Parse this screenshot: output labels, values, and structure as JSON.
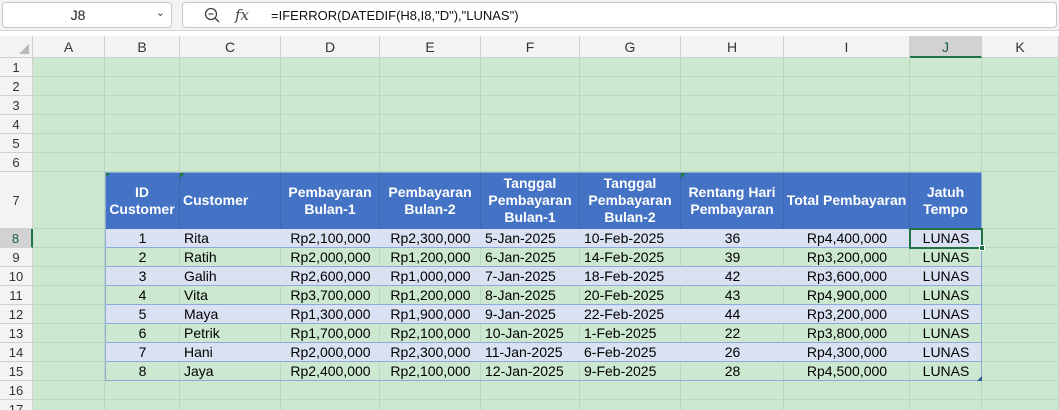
{
  "formula_bar": {
    "name_box": "J8",
    "fx_label": "fx",
    "formula": "=IFERROR(DATEDIF(H8,I8,\"D\"),\"LUNAS\")"
  },
  "columns": [
    "A",
    "B",
    "C",
    "D",
    "E",
    "F",
    "G",
    "H",
    "I",
    "J",
    "K"
  ],
  "selected_column": "J",
  "rows": [
    "1",
    "2",
    "3",
    "4",
    "5",
    "6",
    "7",
    "8",
    "9",
    "10",
    "11",
    "12",
    "13",
    "14",
    "15",
    "16",
    "17"
  ],
  "selected_row": "8",
  "table": {
    "headers": [
      "ID Customer",
      "Customer",
      "Pembayaran Bulan-1",
      "Pembayaran Bulan-2",
      "Tanggal Pembayaran Bulan-1",
      "Tanggal Pembayaran Bulan-2",
      "Rentang Hari Pembayaran",
      "Total Pembayaran",
      "Jatuh Tempo"
    ],
    "rows": [
      [
        "1",
        "Rita",
        "Rp2,100,000",
        "Rp2,300,000",
        "5-Jan-2025",
        "10-Feb-2025",
        "36",
        "Rp4,400,000",
        "LUNAS"
      ],
      [
        "2",
        "Ratih",
        "Rp2,000,000",
        "Rp1,200,000",
        "6-Jan-2025",
        "14-Feb-2025",
        "39",
        "Rp3,200,000",
        "LUNAS"
      ],
      [
        "3",
        "Galih",
        "Rp2,600,000",
        "Rp1,000,000",
        "7-Jan-2025",
        "18-Feb-2025",
        "42",
        "Rp3,600,000",
        "LUNAS"
      ],
      [
        "4",
        "Vita",
        "Rp3,700,000",
        "Rp1,200,000",
        "8-Jan-2025",
        "20-Feb-2025",
        "43",
        "Rp4,900,000",
        "LUNAS"
      ],
      [
        "5",
        "Maya",
        "Rp1,300,000",
        "Rp1,900,000",
        "9-Jan-2025",
        "22-Feb-2025",
        "44",
        "Rp3,200,000",
        "LUNAS"
      ],
      [
        "6",
        "Petrik",
        "Rp1,700,000",
        "Rp2,100,000",
        "10-Jan-2025",
        "1-Feb-2025",
        "22",
        "Rp3,800,000",
        "LUNAS"
      ],
      [
        "7",
        "Hani",
        "Rp2,000,000",
        "Rp2,300,000",
        "11-Jan-2025",
        "6-Feb-2025",
        "26",
        "Rp4,300,000",
        "LUNAS"
      ],
      [
        "8",
        "Jaya",
        "Rp2,400,000",
        "Rp2,100,000",
        "12-Jan-2025",
        "9-Feb-2025",
        "28",
        "Rp4,500,000",
        "LUNAS"
      ]
    ]
  },
  "colors": {
    "grid_background": "#cce8cf",
    "header_fill": "#4472c4",
    "band_fill": "#d9e1f2",
    "selection": "#217346"
  }
}
